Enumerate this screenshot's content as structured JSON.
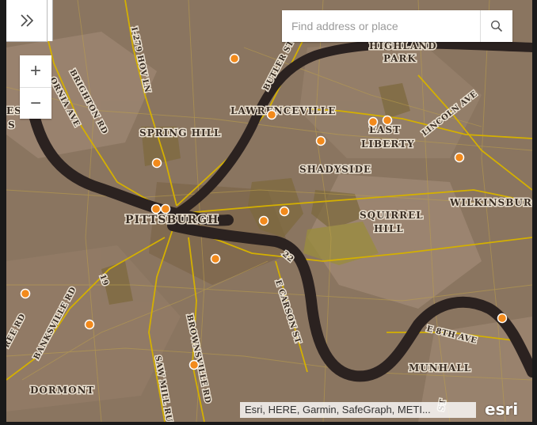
{
  "search": {
    "placeholder": "Find address or place"
  },
  "zoom": {
    "in_label": "+",
    "out_label": "−"
  },
  "expand": {
    "label": "»"
  },
  "attribution": "Esri, HERE, Garmin, SafeGraph, METI...",
  "logo": "esri",
  "colors": {
    "base": "#8a7560",
    "river": "#2b2220",
    "poi": "#f28a1c",
    "road": "#d4b000"
  },
  "labels": {
    "pittsburgh": "PITTSBURGH",
    "lawrenceville": "LAWRENCEVILLE",
    "spring_hill": "SPRING HILL",
    "shadyside": "SHADYSIDE",
    "squirrel": "SQUIRREL",
    "hill": "HILL",
    "east": "EAST",
    "liberty": "LIBERTY",
    "wilkinsburg": "WILKINSBURG",
    "highland": "HIGHLAND",
    "park": "PARK",
    "munhall": "MUNHALL",
    "dormont": "DORMONT",
    "brighton_rd": "BRIGHTON RD",
    "california_ave": "ORNIA AVE",
    "es": "ES",
    "s": "S",
    "i279": "I-279 HOV LN",
    "butler_st": "BUTLER ST",
    "lincoln_ave": "LINCOLN AVE",
    "e_carson_st": "E CARSON ST",
    "e_8th_ave": "E 8TH AVE",
    "saw_mill_run": "SAW MILL RUN",
    "brownsville_rd": "BROWNSVILLE RD",
    "banksville_rd": "BANKSVILLE RD",
    "ree_rd": "REE RD",
    "route_22": "22",
    "route_19": "19",
    "st_frag": "ST"
  }
}
